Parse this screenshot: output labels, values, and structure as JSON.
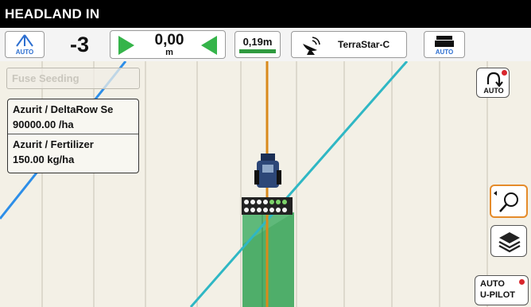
{
  "header": {
    "title": "HEADLAND IN"
  },
  "statusbar": {
    "steer_mode_label": "AUTO",
    "offset_value": "-3",
    "deviation_value": "0,00",
    "deviation_unit": "m",
    "accuracy_value": "0,19m",
    "correction_source": "TerraStar-C",
    "tractor_mode_label": "AUTO"
  },
  "field": {
    "seeding_button_label": "Fuse Seeding",
    "products": [
      {
        "name": "Azurit / DeltaRow Se",
        "rate": "90000.00 /ha"
      },
      {
        "name": "Azurit / Fertilizer",
        "rate": "150.00 kg/ha"
      }
    ]
  },
  "right_controls": {
    "auto_headland_label": "AUTO",
    "autopilot_label_line1": "AUTO",
    "autopilot_label_line2": "U-PILOT"
  },
  "colors": {
    "guidance_line": "#d98a1c",
    "coverage": "#4fae6a",
    "blue_line": "#2d8ee8",
    "cyan_line": "#2fb7c4",
    "active_arrow": "#35b44a",
    "alert_dot": "#d9262d",
    "zoom_border": "#e58b2a"
  }
}
